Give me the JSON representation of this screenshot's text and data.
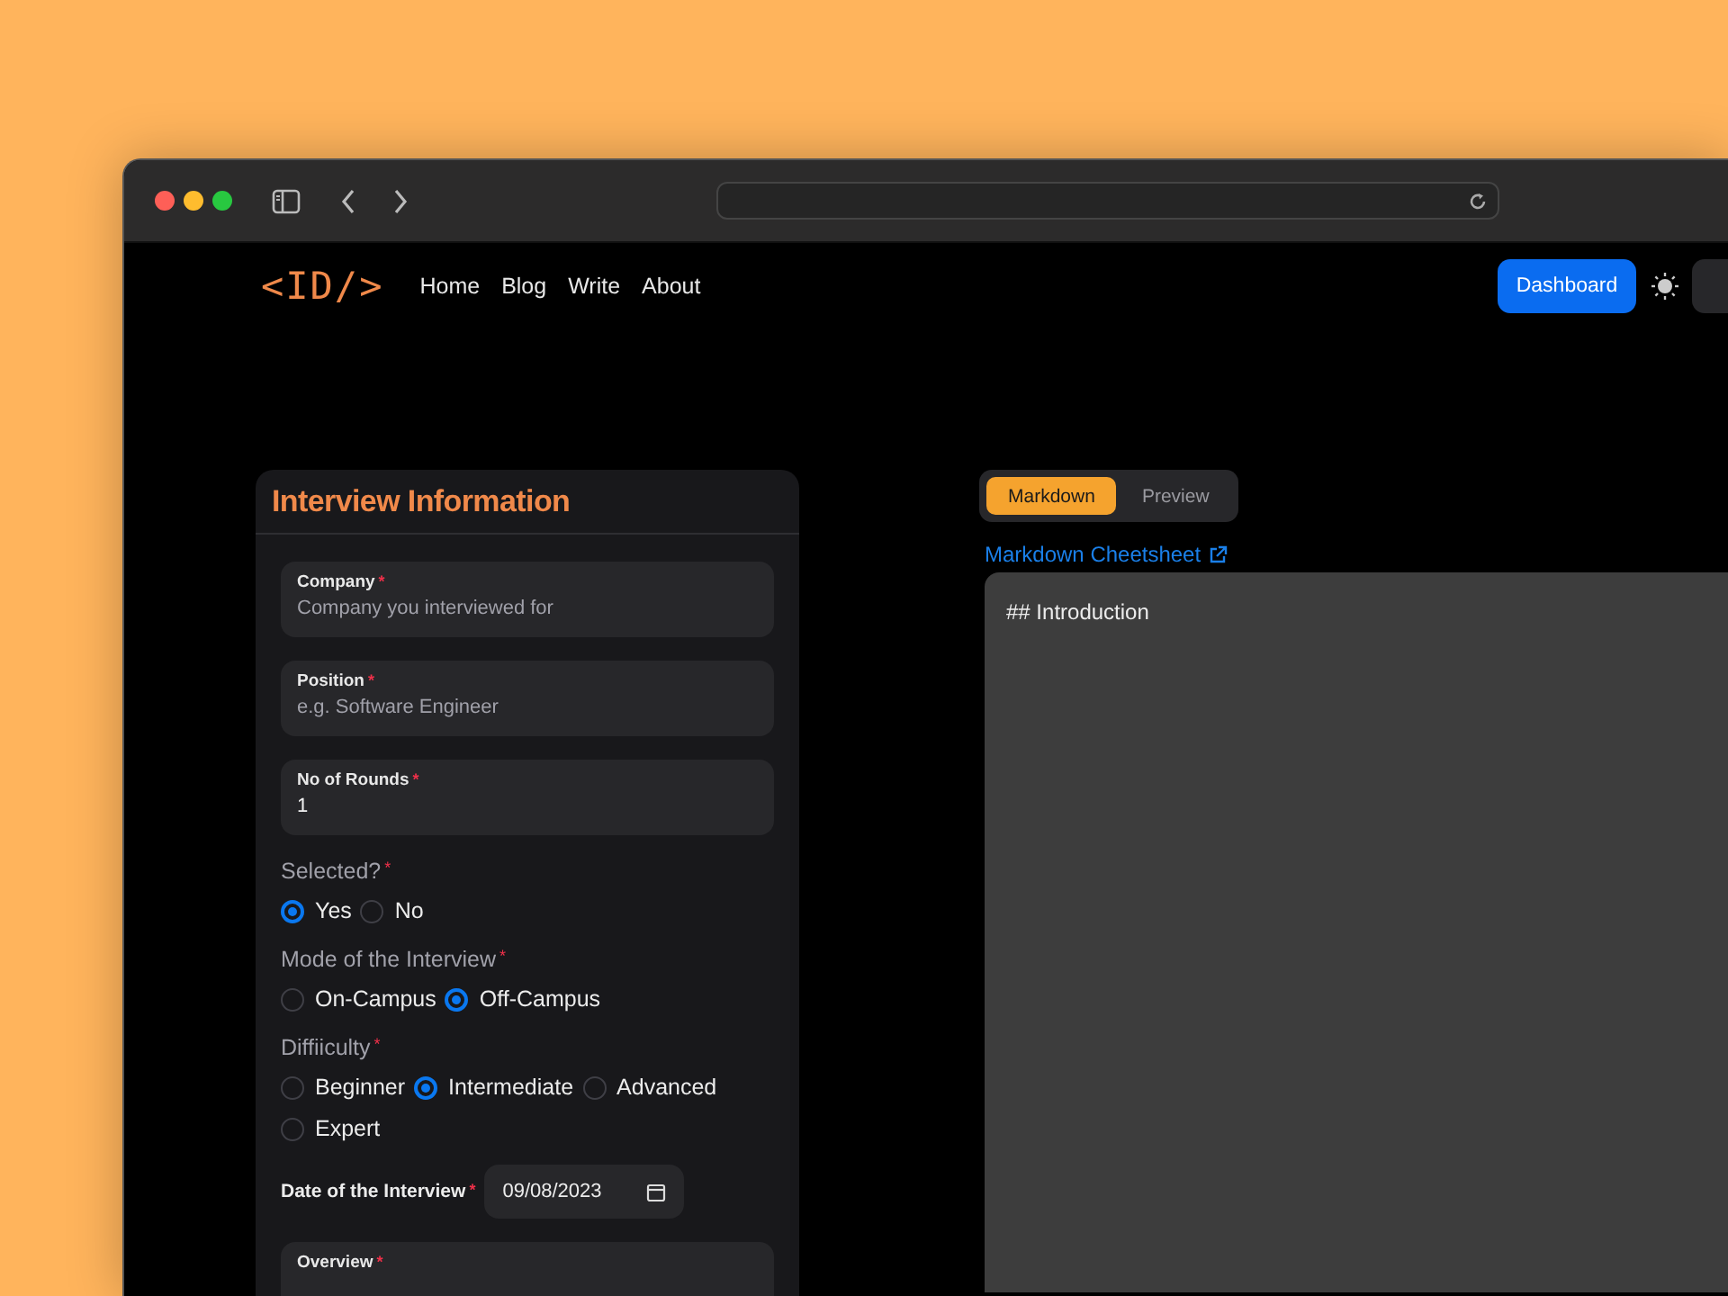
{
  "nav": {
    "logo": "<ID/>",
    "links": [
      "Home",
      "Blog",
      "Write",
      "About"
    ],
    "button": "Dashboard"
  },
  "form": {
    "title": "Interview Information",
    "fields": [
      {
        "kind": "text",
        "label": "Company",
        "required_mark": "*",
        "placeholder": "Company you interviewed for"
      },
      {
        "kind": "text",
        "label": "Position",
        "required_mark": "*",
        "placeholder": "e.g. Software Engineer"
      },
      {
        "kind": "text",
        "label": "No of Rounds",
        "required_mark": "*",
        "value": "1"
      },
      {
        "kind": "radio",
        "label": "Selected?",
        "required_mark": "*",
        "options": [
          {
            "label": "Yes",
            "selected": true
          },
          {
            "label": "No",
            "selected": false
          }
        ]
      },
      {
        "kind": "radio",
        "label": "Mode of the Interview",
        "required_mark": "*",
        "options": [
          {
            "label": "On-Campus",
            "selected": false
          },
          {
            "label": "Off-Campus",
            "selected": true
          }
        ]
      },
      {
        "kind": "radio",
        "label": "Diffiiculty",
        "required_mark": "*",
        "options": [
          {
            "label": "Beginner",
            "selected": false
          },
          {
            "label": "Intermediate",
            "selected": true
          },
          {
            "label": "Advanced",
            "selected": false
          },
          {
            "label": "Expert",
            "selected": false
          }
        ]
      },
      {
        "kind": "date",
        "label": "Date of the Interview",
        "required_mark": "*",
        "value": "09/08/2023"
      },
      {
        "kind": "text",
        "label": "Overview",
        "required_mark": "*"
      }
    ]
  },
  "editor": {
    "tabs": [
      {
        "label": "Markdown",
        "selected": true
      },
      {
        "label": "Preview",
        "selected": false
      }
    ],
    "link": "Markdown Cheetsheet",
    "content": "## Introduction"
  }
}
